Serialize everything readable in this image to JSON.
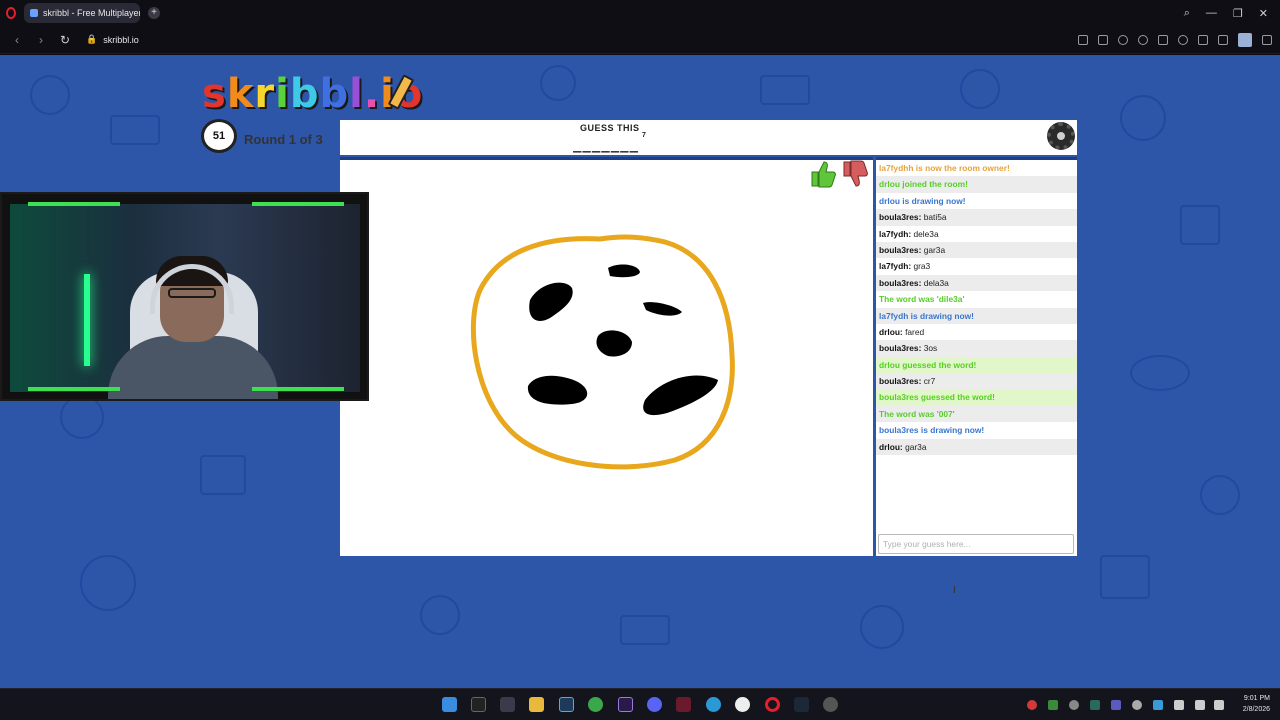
{
  "browser": {
    "tab_title": "skribbl - Free Multiplayer",
    "tab_close": "×",
    "new_tab": "+",
    "url": "skribbl.io",
    "window_min": "—",
    "window_max": "❐",
    "window_close": "✕"
  },
  "header": {
    "round": "Round 1 of 3",
    "timer": "51",
    "guess_label": "GUESS THIS",
    "word_blanks": "_______",
    "word_length": "7"
  },
  "chat": {
    "messages": [
      {
        "type": "system",
        "color": "orange",
        "text": "la7fydhh is now the room owner!"
      },
      {
        "type": "system",
        "color": "green",
        "text": "drlou joined the room!"
      },
      {
        "type": "system",
        "color": "blue",
        "text": "drlou is drawing now!"
      },
      {
        "type": "user",
        "name": "boula3res:",
        "text": "bati5a"
      },
      {
        "type": "user",
        "name": "la7fydh:",
        "text": "dele3a"
      },
      {
        "type": "user",
        "name": "boula3res:",
        "text": "gar3a"
      },
      {
        "type": "user",
        "name": "la7fydh:",
        "text": "gra3"
      },
      {
        "type": "user",
        "name": "boula3res:",
        "text": "dela3a"
      },
      {
        "type": "system",
        "color": "green",
        "text": "The word was 'dile3a'"
      },
      {
        "type": "system",
        "color": "blue",
        "text": "la7fydh is drawing now!"
      },
      {
        "type": "user",
        "name": "drlou:",
        "text": "fared"
      },
      {
        "type": "user",
        "name": "boula3res:",
        "text": "3os"
      },
      {
        "type": "guess",
        "color": "green",
        "text": "drlou guessed the word!"
      },
      {
        "type": "user",
        "name": "boula3res:",
        "text": "cr7"
      },
      {
        "type": "guess",
        "color": "green",
        "text": "boula3res guessed the word!"
      },
      {
        "type": "system",
        "color": "green",
        "text": "The word was '007'"
      },
      {
        "type": "system",
        "color": "blue",
        "text": "boula3res is drawing now!"
      },
      {
        "type": "user",
        "name": "drlou:",
        "text": "gar3a"
      }
    ],
    "input_placeholder": "Type your guess here..."
  },
  "taskbar": {
    "time": "9:01 PM",
    "date": "2/8/2026"
  },
  "colors": {
    "page_bg": "#2d55a8",
    "system_orange": "#e6a33d",
    "system_green": "#56ce27",
    "system_blue": "#3975ce",
    "drawing_outline": "#e8a71c"
  }
}
